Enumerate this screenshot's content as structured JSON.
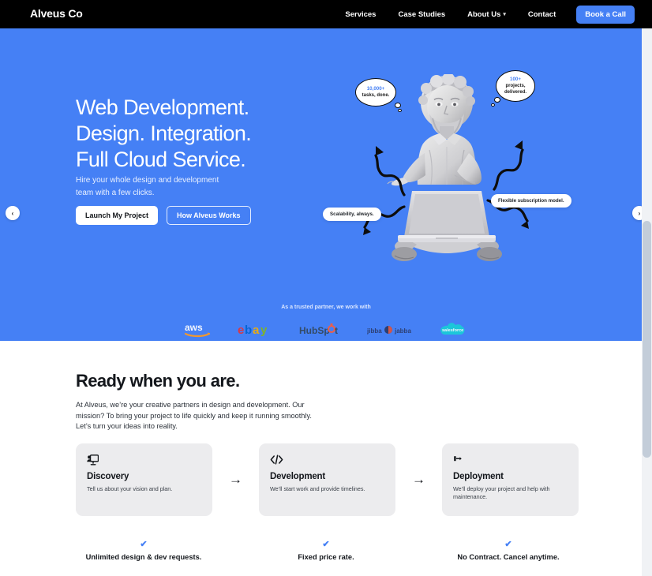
{
  "nav": {
    "brand": "Alveus Co",
    "links": [
      {
        "label": "Services",
        "icon": ""
      },
      {
        "label": "Case Studies",
        "icon": ""
      },
      {
        "label": "About Us",
        "icon": "chevron-down-icon"
      },
      {
        "label": "Contact",
        "icon": ""
      }
    ],
    "cta": "Book a Call"
  },
  "hero": {
    "title_line1": "Web Development.",
    "title_line2": "Design. Integration.",
    "title_line3": "Full Cloud Service.",
    "sub_line1": "Hire your whole design and development",
    "sub_line2": "team with a few clicks.",
    "primary_button": "Launch My Project",
    "secondary_button": "How Alveus Works",
    "prev_arrow": "‹",
    "next_arrow": "›",
    "bubbles": [
      {
        "name": "tasks-bubble",
        "stat": "10,000+",
        "text": "tasks, done."
      },
      {
        "name": "projects-bubble",
        "stat": "100+",
        "text": "projects,\ndelivered."
      }
    ],
    "pills": [
      {
        "name": "scalability-pill",
        "text": "Scalability, always."
      },
      {
        "name": "subscription-pill",
        "text": "Flexible subscription model."
      }
    ],
    "bg_color": "#4580f5"
  },
  "partners": {
    "label": "As a trusted partner, we work with",
    "logos": [
      {
        "name": "aws-logo",
        "text": "aws"
      },
      {
        "name": "ebay-logo",
        "text": "ebay"
      },
      {
        "name": "hubspot-logo",
        "text": "HubSpot"
      },
      {
        "name": "jibbajabba-logo",
        "text": "jibba jabba"
      },
      {
        "name": "salesforce-logo",
        "text": "salesforce"
      }
    ]
  },
  "section2": {
    "title": "Ready when you are.",
    "body": "At Alveus, we’re your creative partners in design and development. Our mission? To bring your project to life quickly and keep it running smoothly. Let’s turn your ideas into reality.",
    "arrow": "→",
    "cards": [
      {
        "icon": "presentation-user-icon",
        "title": "Discovery",
        "desc": "Tell us about your vision and plan."
      },
      {
        "icon": "code-brackets-icon",
        "title": "Development",
        "desc": "We’ll start work and provide timelines."
      },
      {
        "icon": "rocket-launch-icon",
        "title": "Deployment",
        "desc": "We’ll deploy your project and help with maintenance."
      }
    ]
  },
  "features": {
    "check": "✔",
    "items": [
      {
        "label": "Unlimited design & dev requests."
      },
      {
        "label": "Fixed price rate."
      },
      {
        "label": "No Contract. Cancel anytime."
      }
    ]
  },
  "colors": {
    "brand_blue": "#4580f5",
    "nav_black": "#000000",
    "card_gray": "#ececee"
  }
}
